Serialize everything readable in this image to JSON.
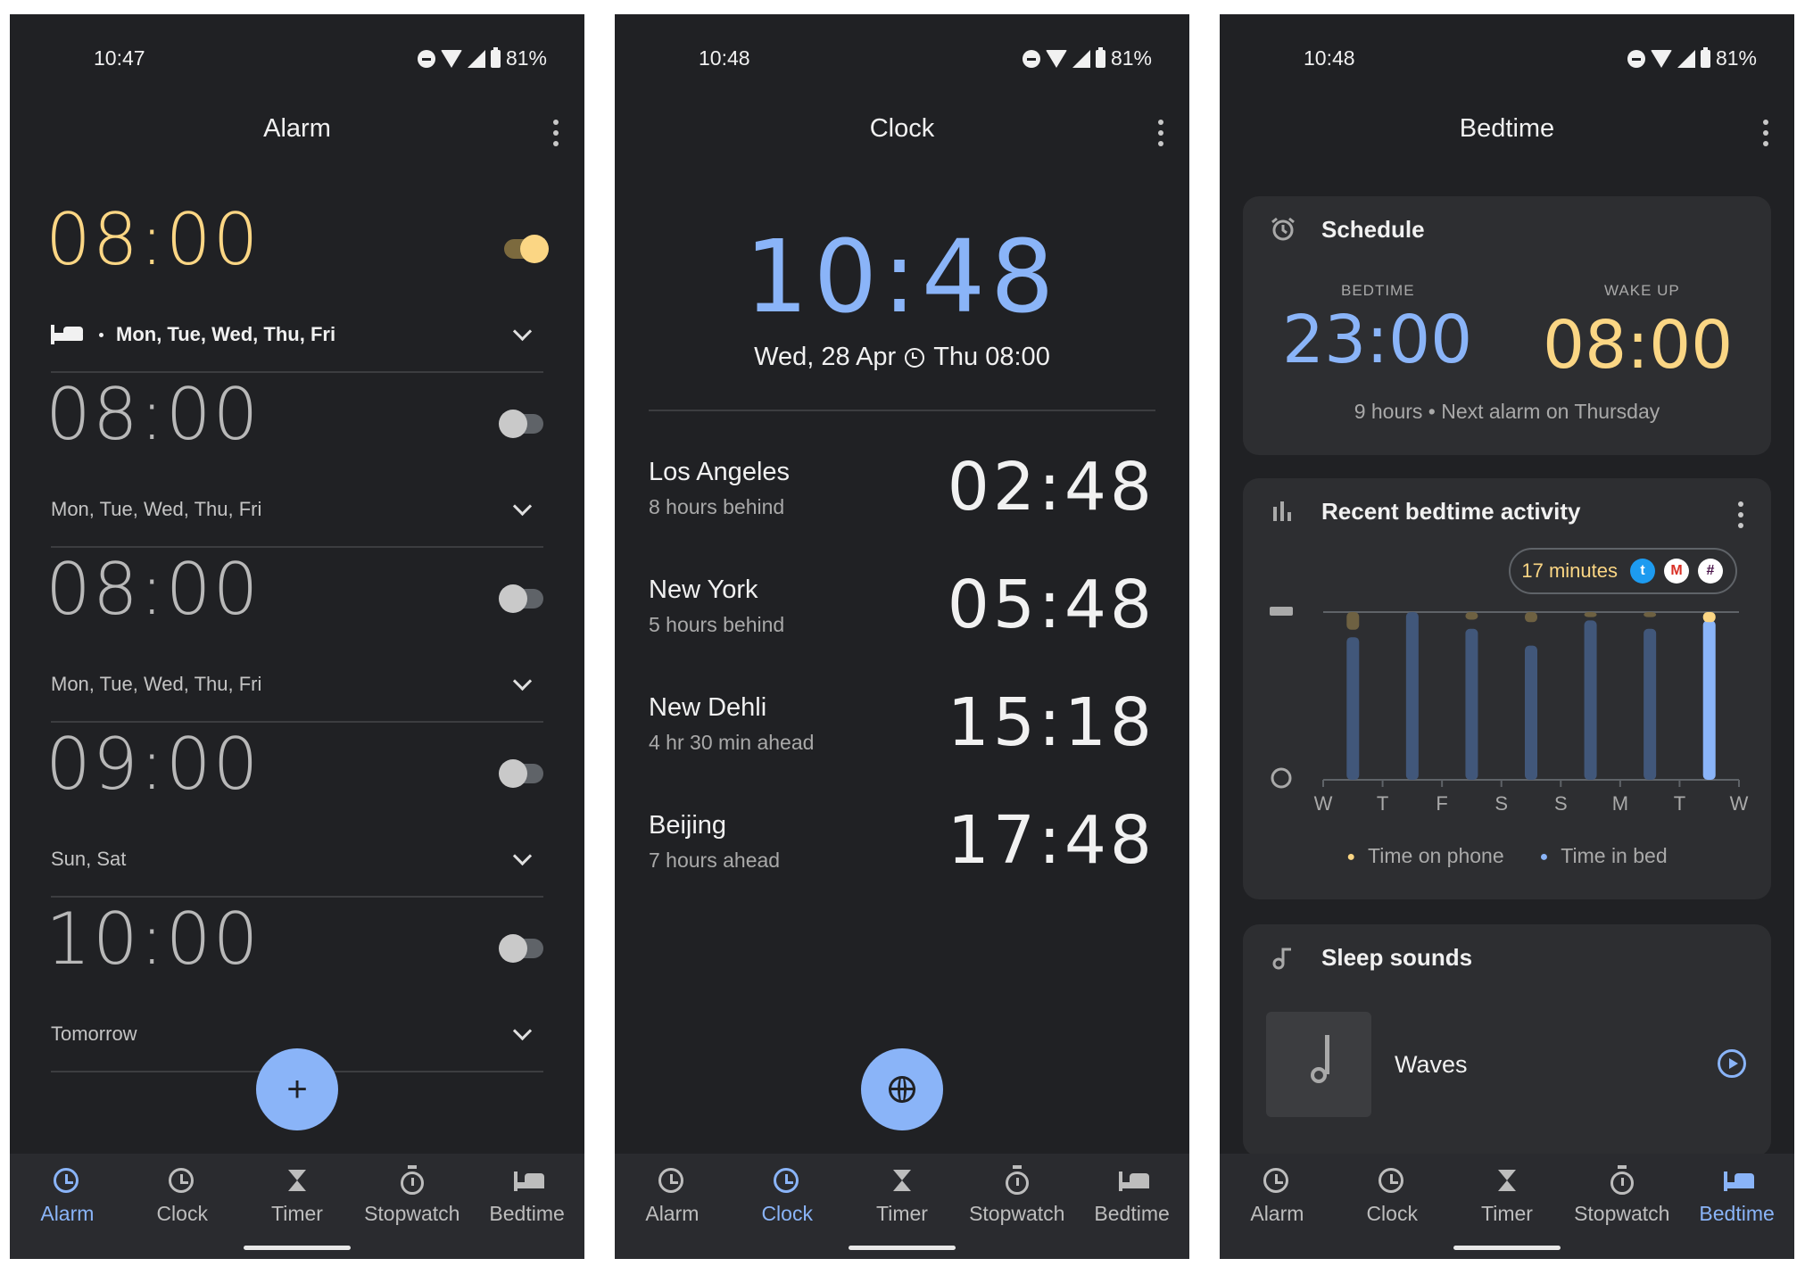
{
  "colors": {
    "accent_blue": "#8ab4f8",
    "accent_yellow": "#fbd684",
    "background": "#202124"
  },
  "status": {
    "alarm_screen_time": "10:47",
    "clock_screen_time": "10:48",
    "bedtime_screen_time": "10:48",
    "battery": "81%"
  },
  "nav": {
    "alarm": "Alarm",
    "clock": "Clock",
    "timer": "Timer",
    "stopwatch": "Stopwatch",
    "bedtime": "Bedtime"
  },
  "alarm_screen": {
    "title": "Alarm",
    "alarms": [
      {
        "time": "08:00",
        "days": "Mon, Tue, Wed, Thu, Fri",
        "enabled": true
      },
      {
        "time": "08:00",
        "days": "Mon, Tue, Wed, Thu, Fri",
        "enabled": false
      },
      {
        "time": "08:00",
        "days": "Mon, Tue, Wed, Thu, Fri",
        "enabled": false
      },
      {
        "time": "09:00",
        "days": "Sun, Sat",
        "enabled": false
      },
      {
        "time": "10:00",
        "days": "Tomorrow",
        "enabled": false
      }
    ],
    "fab_label": "+"
  },
  "clock_screen": {
    "title": "Clock",
    "local_time": "10:48",
    "date": "Wed, 28 Apr",
    "next_alarm": "Thu 08:00",
    "cities": [
      {
        "name": "Los Angeles",
        "offset": "8 hours behind",
        "time": "02:48"
      },
      {
        "name": "New York",
        "offset": "5 hours behind",
        "time": "05:48"
      },
      {
        "name": "New Dehli",
        "offset": "4 hr 30 min ahead",
        "time": "15:18"
      },
      {
        "name": "Beijing",
        "offset": "7 hours ahead",
        "time": "17:48"
      }
    ]
  },
  "bedtime_screen": {
    "title": "Bedtime",
    "schedule": {
      "heading": "Schedule",
      "bedtime_label": "BEDTIME",
      "bedtime": "23:00",
      "wakeup_label": "WAKE UP",
      "wakeup": "08:00",
      "info": "9 hours • Next alarm on Thursday"
    },
    "activity": {
      "heading": "Recent bedtime activity",
      "chip_text": "17 minutes",
      "apps": [
        "twitter-icon",
        "gmail-icon",
        "slack-icon"
      ],
      "legend_phone": "Time on phone",
      "legend_bed": "Time in bed"
    },
    "sounds": {
      "heading": "Sleep sounds",
      "track": "Waves"
    }
  },
  "chart_data": {
    "type": "bar",
    "categories": [
      "W",
      "T",
      "F",
      "S",
      "S",
      "M",
      "T",
      "W"
    ],
    "series": [
      {
        "name": "Time on phone",
        "values": [
          0.35,
          0,
          0.15,
          0.2,
          0.1,
          0.1,
          0.2
        ]
      },
      {
        "name": "Time in bed",
        "values": [
          8.5,
          10,
          9,
          8,
          9.5,
          9,
          9.5
        ]
      }
    ],
    "ylabel": "",
    "grid": true
  }
}
